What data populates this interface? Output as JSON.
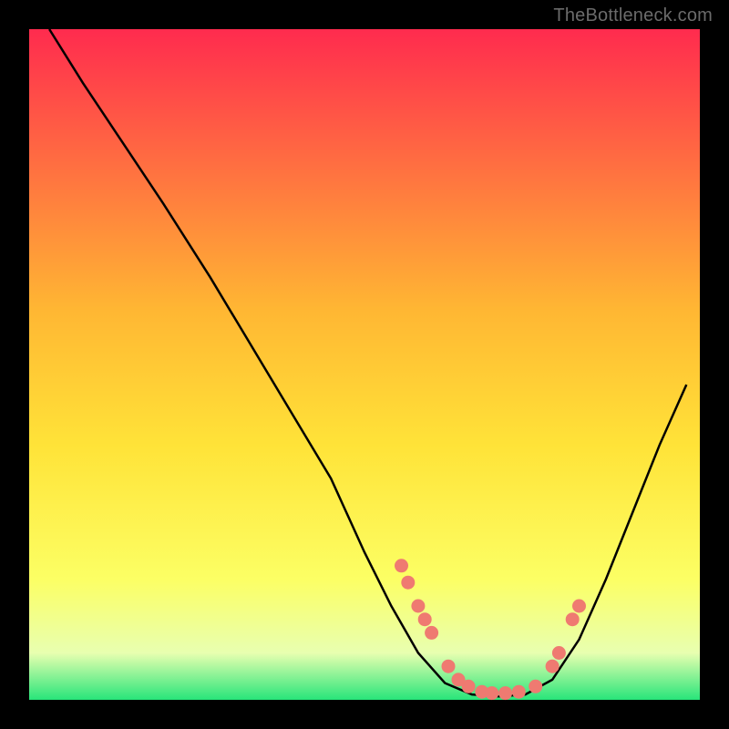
{
  "watermark": "TheBottleneck.com",
  "colors": {
    "background": "#000000",
    "curve": "#000000",
    "dot_fill": "#ef7a71",
    "dot_stroke": "#ef7a71",
    "gradient_top": "#ff2b4e",
    "gradient_mid_upper": "#ffb733",
    "gradient_mid": "#ffe338",
    "gradient_mid_lower": "#fcff64",
    "gradient_low": "#e8ffb0",
    "gradient_bottom": "#28e57a"
  },
  "chart_data": {
    "type": "line",
    "title": "",
    "xlabel": "",
    "ylabel": "",
    "xlim": [
      0,
      100
    ],
    "ylim": [
      0,
      100
    ],
    "grid": false,
    "legend": false,
    "series": [
      {
        "name": "bottleneck-curve",
        "x": [
          3,
          8,
          14,
          20,
          27,
          33,
          39,
          45,
          50,
          54,
          58,
          62,
          66,
          70,
          74,
          78,
          82,
          86,
          90,
          94,
          98
        ],
        "y": [
          100,
          92,
          83,
          74,
          63,
          53,
          43,
          33,
          22,
          14,
          7,
          2.5,
          0.8,
          0.5,
          0.8,
          3,
          9,
          18,
          28,
          38,
          47
        ]
      }
    ],
    "scatter_points": {
      "name": "data-dots",
      "x": [
        55.5,
        56.5,
        58,
        59,
        60,
        62.5,
        64,
        65.5,
        67.5,
        69,
        71,
        73,
        75.5,
        78,
        79,
        81,
        82
      ],
      "y": [
        20,
        17.5,
        14,
        12,
        10,
        5,
        3,
        2,
        1.2,
        1,
        1,
        1.2,
        2,
        5,
        7,
        12,
        14
      ]
    }
  }
}
